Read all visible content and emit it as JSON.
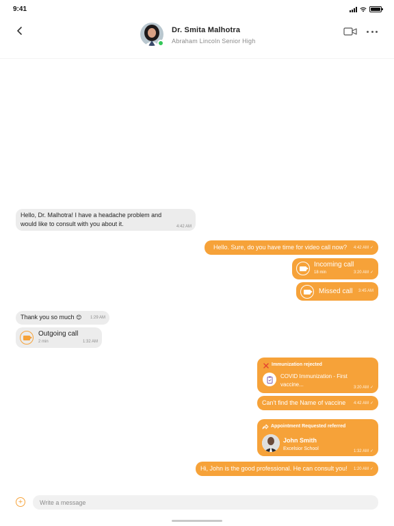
{
  "status_bar": {
    "time": "9:41"
  },
  "header": {
    "name": "Dr. Smita Malhotra",
    "school": "Abraham Lincoln Senior High",
    "online": true
  },
  "messages": {
    "m1": {
      "text": "Hello, Dr. Malhotra! I have a headache problem and would like to consult with you about it.",
      "time": "4:42 AM"
    },
    "m2": {
      "text": "Hello. Sure, do you have time for video call now?",
      "time": "4:42 AM"
    },
    "m3": {
      "title": "Incoming call",
      "duration": "18 min",
      "time": "3:20 AM"
    },
    "m4": {
      "title": "Missed call",
      "time": "3:45 AM"
    },
    "m5": {
      "text": "Thank you so much",
      "emoji": "😊",
      "time": "1:29 AM"
    },
    "m6": {
      "title": "Outgoing call",
      "duration": "2 min",
      "time": "1:32 AM"
    },
    "m7": {
      "title": "Immunization rejected",
      "body": "COVID Immunization - First vaccine...",
      "time": "3:20 AM"
    },
    "m8": {
      "text": "Can't find the Name of vaccine",
      "time": "4:42 AM"
    },
    "m9": {
      "title": "Appointment Requested referred",
      "person_name": "John Smith",
      "person_school": "Excelsior School",
      "time": "1:32 AM"
    },
    "m10": {
      "text": "Hi, John is the good professional. He can consult you!",
      "time": "1:20 AM"
    }
  },
  "composer": {
    "placeholder": "Write a message",
    "value": ""
  },
  "colors": {
    "accent": "#f6a239",
    "incoming_bubble": "#ececec",
    "online": "#34c759",
    "rejected": "#e5432f"
  },
  "icons": [
    "back-chevron-icon",
    "video-camera-icon",
    "more-dots-icon",
    "video-call-icon",
    "close-x-icon",
    "clipboard-icon",
    "forward-arrow-icon",
    "plus-circle-icon"
  ]
}
